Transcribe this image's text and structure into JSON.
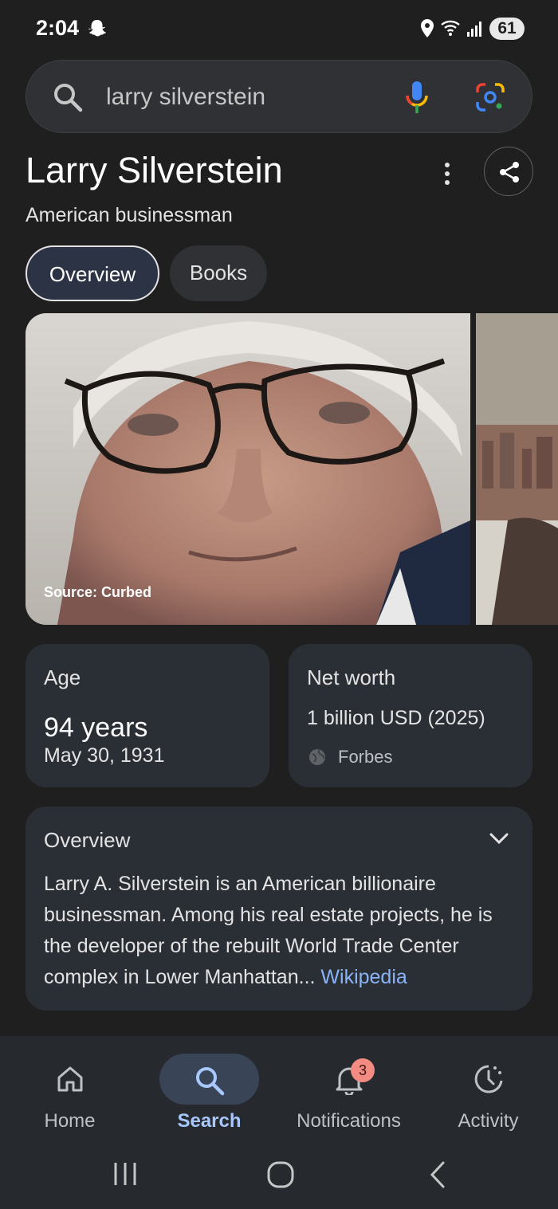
{
  "status_bar": {
    "time": "2:04",
    "battery": "61"
  },
  "search": {
    "query": "larry silverstein"
  },
  "header": {
    "title": "Larry Silverstein",
    "subtitle": "American businessman"
  },
  "tabs": [
    {
      "label": "Overview"
    },
    {
      "label": "Books"
    }
  ],
  "image": {
    "source": "Source: Curbed"
  },
  "age_card": {
    "label": "Age",
    "value": "94 years",
    "birth_date": "May 30, 1931"
  },
  "net_worth_card": {
    "label": "Net worth",
    "value": "1 billion USD (2025)",
    "source": "Forbes"
  },
  "overview_card": {
    "label": "Overview",
    "text": "Larry A. Silverstein is an American billionaire businessman. Among his real estate projects, he is the developer of the rebuilt World Trade Center complex in Lower Manhattan",
    "ellipsis": "...",
    "link": "Wikipedia"
  },
  "bottom_nav": [
    {
      "label": "Home",
      "icon": "home-icon"
    },
    {
      "label": "Search",
      "icon": "search-icon",
      "active": true
    },
    {
      "label": "Notifications",
      "icon": "bell-icon",
      "badge": "3"
    },
    {
      "label": "Activity",
      "icon": "activity-icon"
    }
  ],
  "colors": {
    "background": "#1f1f1f",
    "card": "#2a2e35",
    "link": "#8ab4f8",
    "active_nav": "#a8c7fa",
    "badge": "#f28b82"
  }
}
